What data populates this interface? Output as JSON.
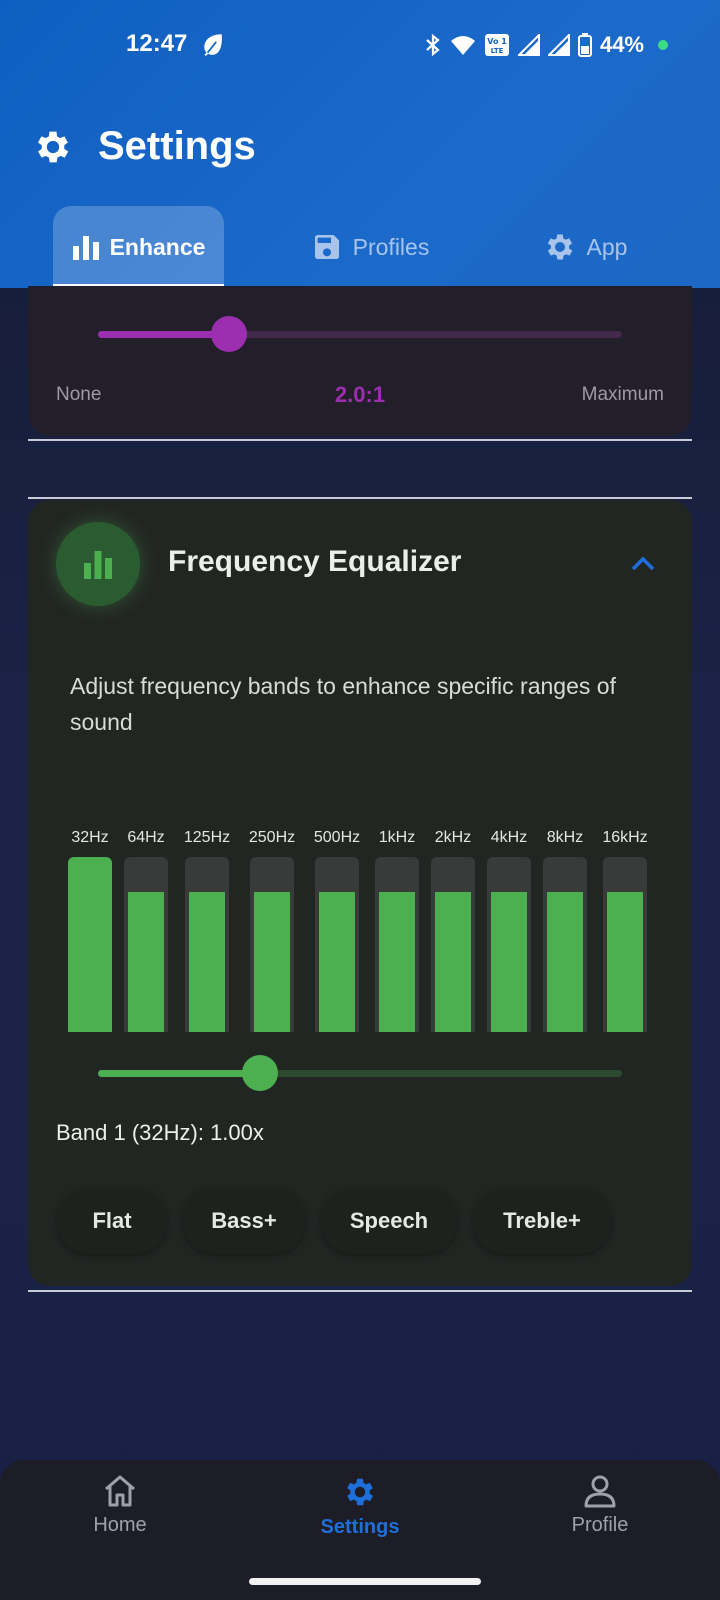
{
  "status_bar": {
    "time": "12:47",
    "battery": "44%"
  },
  "header": {
    "title": "Settings",
    "tabs": [
      {
        "label": "Enhance",
        "icon": "bar-chart-icon",
        "active": true
      },
      {
        "label": "Profiles",
        "icon": "save-icon",
        "active": false
      },
      {
        "label": "App",
        "icon": "gear-icon",
        "active": false
      }
    ]
  },
  "compressor": {
    "min_label": "None",
    "value_label": "2.0:1",
    "max_label": "Maximum",
    "level": 0.25,
    "accent": "#9c2fb0"
  },
  "equalizer": {
    "title": "Frequency Equalizer",
    "description": "Adjust frequency bands to enhance specific ranges of sound",
    "bands": [
      {
        "label": "32Hz",
        "level": 1.0
      },
      {
        "label": "64Hz",
        "level": 0.8
      },
      {
        "label": "125Hz",
        "level": 0.8
      },
      {
        "label": "250Hz",
        "level": 0.8
      },
      {
        "label": "500Hz",
        "level": 0.8
      },
      {
        "label": "1kHz",
        "level": 0.8
      },
      {
        "label": "2kHz",
        "level": 0.8
      },
      {
        "label": "4kHz",
        "level": 0.8
      },
      {
        "label": "8kHz",
        "level": 0.8
      },
      {
        "label": "16kHz",
        "level": 0.8
      }
    ],
    "selected_band_slider": 0.31,
    "readout": "Band 1 (32Hz): 1.00x",
    "presets": [
      "Flat",
      "Bass+",
      "Speech",
      "Treble+"
    ],
    "accent": "#4caf50"
  },
  "bottom_nav": {
    "items": [
      {
        "label": "Home",
        "icon": "home-icon",
        "active": false
      },
      {
        "label": "Settings",
        "icon": "gear-icon",
        "active": true
      },
      {
        "label": "Profile",
        "icon": "person-icon",
        "active": false
      }
    ],
    "active_color": "#1e6fd9",
    "inactive_color": "#a0a0aa"
  }
}
